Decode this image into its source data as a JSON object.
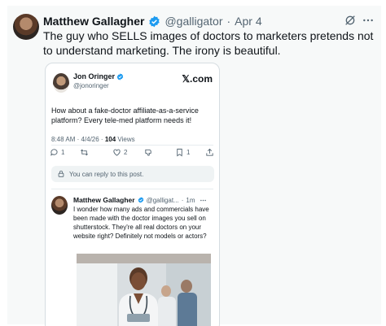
{
  "post": {
    "author_name": "Matthew Gallagher",
    "handle": "@galligator",
    "separator": "·",
    "date": "Apr 4",
    "text": "The guy who SELLS images of doctors to marketers pretends not to understand marketing. The irony is beautiful."
  },
  "quoted_post": {
    "author_name": "Jon Oringer",
    "handle": "@jonoringer",
    "brand": "𝕏.com",
    "text": "How about a fake-doctor affiliate-as-a-service platform? Every tele-med platform needs it!",
    "time": "8:48 AM · 4/4/26 · ",
    "views_count": "104",
    "views_label": " Views",
    "actions": {
      "replies": "1",
      "likes": "2",
      "bookmarks": "1"
    },
    "reply_restricted": "You can reply to this post."
  },
  "reply": {
    "author_name": "Matthew Gallagher",
    "handle": "@galligat...",
    "separator": "·",
    "time": "1m",
    "text": "I wonder how many ads and commercials have been made with the doctor images you sell on shutterstock. They're all real doctors on your website right? Definitely not models or actors?"
  },
  "colors": {
    "verified": "#1d9bf0",
    "muted": "#536471",
    "background": "#f7f9f9"
  },
  "icons": [
    "verified-badge-icon",
    "grok-icon",
    "more-icon",
    "reply-icon",
    "repost-icon",
    "like-icon",
    "dislike-icon",
    "bookmark-icon",
    "share-icon",
    "lock-icon"
  ]
}
